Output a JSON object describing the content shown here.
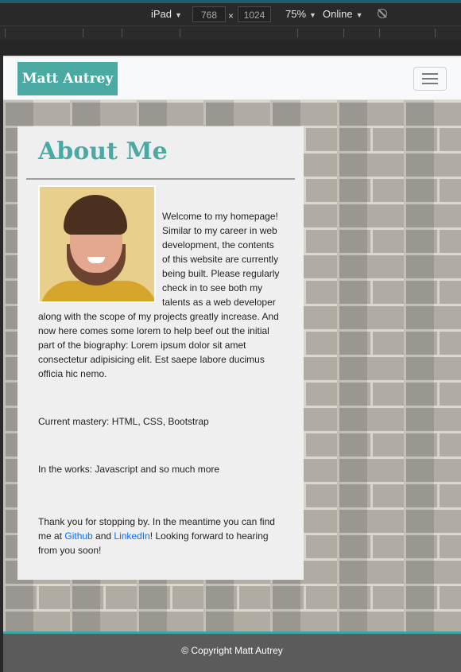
{
  "devtools": {
    "device": "iPad",
    "width": "768",
    "times": "×",
    "height": "1024",
    "zoom": "75%",
    "network": "Online",
    "caret": "▼"
  },
  "nav": {
    "brand": "Matt Autrey"
  },
  "about": {
    "heading": "About Me",
    "intro": "Welcome to my homepage! Similar to my career in web development, the contents of this website are currently being built. Please regularly check in to see both my talents as a web developer along with the scope of my projects greatly increase. And now here comes some lorem to help beef out the initial part of the biography: Lorem ipsum dolor sit amet consectetur adipisicing elit. Est saepe labore ducimus officia hic nemo.",
    "mastery": "Current mastery: HTML, CSS, Bootstrap",
    "works": "In the works: Javascript and so much more",
    "thanks_pre": "Thank you for stopping by. In the meantime you can find me at ",
    "github": "Github",
    "and": " and ",
    "linkedin": "LinkedIn",
    "thanks_post": "! Looking forward to hearing from you soon!"
  },
  "footer": {
    "copyright": "© Copyright Matt Autrey"
  }
}
